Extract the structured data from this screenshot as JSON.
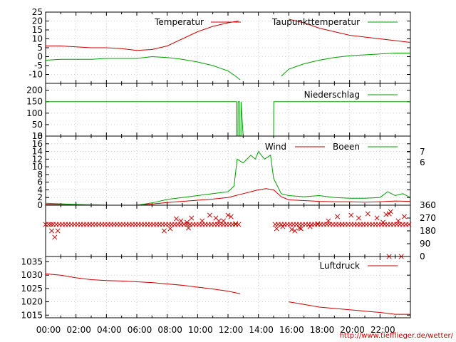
{
  "credit": "http://www.tiefflieger.de/wetter/",
  "x_ticks": [
    "00:00",
    "02:00",
    "04:00",
    "06:00",
    "08:00",
    "10:00",
    "12:00",
    "14:00",
    "16:00",
    "18:00",
    "20:00",
    "22:00"
  ],
  "colors": {
    "red": "#cc0000",
    "green": "#00a000",
    "grid": "#b0b0b0",
    "axis": "#000000"
  },
  "chart_data": [
    {
      "type": "line",
      "xlim": [
        0,
        24
      ],
      "ylim": [
        -15,
        25
      ],
      "y_ticks": [
        25,
        20,
        15,
        10,
        5,
        0,
        -5,
        -10
      ],
      "y_tick_labels": [
        "25",
        "20",
        "15",
        "10",
        "5",
        "0",
        "-5",
        "-10"
      ],
      "grid": true,
      "legend_placement": "top",
      "series": [
        {
          "name": "Temperatur",
          "color": "red",
          "x": [
            0,
            1,
            2,
            3,
            4,
            5,
            6,
            7,
            8,
            9,
            10,
            11,
            12,
            12.7,
            15,
            16,
            17,
            18,
            19,
            20,
            21,
            22,
            23,
            24
          ],
          "y": [
            6,
            6,
            5.5,
            5,
            5,
            4.5,
            3.5,
            4,
            6,
            10,
            14,
            17,
            19,
            20,
            null,
            21,
            19,
            16,
            14,
            12,
            11,
            10,
            9,
            8
          ]
        },
        {
          "name": "Taupunkttemperatur",
          "color": "green",
          "x": [
            0,
            1,
            2,
            3,
            4,
            5,
            6,
            7,
            8,
            9,
            10,
            11,
            11.5,
            12,
            12.5,
            12.8,
            15,
            15.5,
            16,
            17,
            18,
            19,
            20,
            21,
            22,
            23,
            24
          ],
          "y": [
            -2,
            -1.5,
            -1.5,
            -1.5,
            -1,
            -1,
            -1,
            0,
            -0.5,
            -1.5,
            -3,
            -5,
            -6.5,
            -8,
            -11,
            -13,
            null,
            -11,
            -7,
            -4,
            -2,
            -0.5,
            0.5,
            1,
            1.5,
            2,
            2
          ]
        }
      ]
    },
    {
      "type": "line",
      "xlim": [
        0,
        24
      ],
      "ylim": [
        0,
        230
      ],
      "y_ticks": [
        200,
        150,
        100,
        50,
        0
      ],
      "y_tick_labels": [
        "200",
        "150",
        "100",
        "50",
        "0"
      ],
      "grid": true,
      "legend_placement": "top-right",
      "series": [
        {
          "name": "Niederschlag",
          "color": "green",
          "x": [
            0,
            12.55,
            12.56,
            12.65,
            12.66,
            12.75,
            12.76,
            12.85,
            12.86,
            13.0,
            15.0,
            15.01,
            24
          ],
          "y": [
            150,
            150,
            0,
            0,
            150,
            150,
            0,
            0,
            150,
            0,
            0,
            150,
            150
          ]
        }
      ]
    },
    {
      "type": "line",
      "xlim": [
        0,
        24
      ],
      "ylim": [
        0,
        18
      ],
      "y_ticks": [
        18,
        16,
        14,
        12,
        10,
        8,
        6,
        4,
        2,
        0
      ],
      "y_tick_labels": [
        "18",
        "16",
        "14",
        "12",
        "10",
        "8",
        "6",
        "4",
        "2",
        "0"
      ],
      "y2_ticks": [
        7,
        6
      ],
      "y2_tick_labels": [
        "7",
        "6"
      ],
      "grid": true,
      "legend_placement": "top-right",
      "series": [
        {
          "name": "Wind",
          "color": "red",
          "x": [
            0,
            2,
            4,
            6,
            7,
            8,
            9,
            10,
            11,
            12,
            12.5,
            13,
            13.5,
            14,
            14.5,
            15,
            15.5,
            16,
            17,
            18,
            19,
            20,
            21,
            22,
            23,
            24
          ],
          "y": [
            0.2,
            0.1,
            0,
            0,
            0.3,
            0.7,
            1,
            1.3,
            1.6,
            2,
            2.5,
            3,
            3.5,
            4,
            4.3,
            4,
            2.2,
            1.4,
            1.2,
            1,
            0.9,
            0.9,
            0.8,
            0.9,
            1.1,
            1
          ]
        },
        {
          "name": "Boeen",
          "color": "green",
          "x": [
            0,
            2,
            4,
            6,
            7,
            8,
            9,
            10,
            11,
            12,
            12.4,
            12.6,
            13,
            13.5,
            13.8,
            14,
            14.4,
            14.8,
            15,
            15.5,
            16,
            17,
            18,
            19,
            20,
            21,
            22,
            22.5,
            23,
            23.5,
            24
          ],
          "y": [
            0.5,
            0.2,
            0,
            0,
            0.6,
            1.5,
            2,
            2.5,
            3,
            3.5,
            5,
            12,
            11,
            13,
            12,
            14,
            12,
            13,
            7,
            3,
            2.5,
            2.2,
            2.5,
            2,
            1.8,
            1.8,
            2,
            3.5,
            2.5,
            3,
            2
          ]
        }
      ]
    },
    {
      "type": "scatter",
      "xlim": [
        0,
        24
      ],
      "ylim": [
        0,
        360
      ],
      "y2_ticks": [
        360,
        270,
        180,
        90,
        0
      ],
      "y2_tick_labels": [
        "360",
        "270",
        "180",
        "90",
        "0"
      ],
      "grid": true,
      "series": [
        {
          "name": "",
          "color": "red",
          "x": [
            0,
            0.2,
            0.35,
            0.5,
            0.7,
            0.9,
            1.1,
            1.3,
            1.5,
            1.7,
            1.9,
            2.1,
            2.3,
            2.5,
            2.7,
            2.9,
            3.1,
            3.3,
            3.5,
            3.7,
            3.9,
            4.1,
            4.3,
            4.5,
            4.7,
            4.9,
            5.1,
            5.3,
            5.5,
            5.7,
            5.9,
            6.1,
            6.3,
            6.5,
            6.7,
            6.9,
            7.1,
            7.3,
            7.5,
            7.7,
            7.9,
            8.1,
            8.3,
            8.5,
            8.7,
            8.9,
            9.1,
            9.3,
            9.5,
            9.7,
            9.9,
            10.1,
            10.3,
            10.5,
            10.7,
            10.9,
            11.1,
            11.3,
            11.5,
            11.7,
            11.9,
            12.1,
            12.3,
            12.5,
            12.7,
            15.1,
            15.3,
            15.5,
            15.7,
            15.9,
            16.1,
            16.3,
            16.5,
            16.7,
            16.9,
            17.1,
            17.3,
            17.5,
            17.7,
            17.9,
            18.1,
            18.3,
            18.5,
            18.7,
            18.9,
            19.1,
            19.3,
            19.5,
            19.7,
            19.9,
            20.1,
            20.3,
            20.5,
            20.7,
            20.9,
            21.1,
            21.3,
            21.5,
            21.7,
            21.9,
            22.1,
            22.3,
            22.5,
            22.7,
            22.9,
            23.1,
            23.3,
            23.5,
            23.7,
            23.9,
            0.4,
            0.6,
            0.8,
            8.6,
            8.9,
            9.3,
            9.6,
            10.3,
            10.8,
            11.2,
            11.7,
            12.2,
            12.5,
            15.2,
            15.6,
            16.2,
            16.7,
            17.4,
            17.9,
            18.6,
            19.2,
            20.1,
            20.6,
            21.2,
            21.8,
            22.2,
            22.6,
            23.2,
            23.6,
            7.8,
            8.2,
            9.4,
            11.4,
            12.0,
            16.4,
            16.8,
            19.5,
            22.6,
            23.4,
            22.4,
            22.7
          ],
          "y": [
            225,
            225,
            225,
            225,
            225,
            225,
            225,
            225,
            225,
            225,
            225,
            225,
            225,
            225,
            225,
            225,
            225,
            225,
            225,
            225,
            225,
            225,
            225,
            225,
            225,
            225,
            225,
            225,
            225,
            225,
            225,
            225,
            225,
            225,
            225,
            225,
            225,
            225,
            225,
            225,
            225,
            225,
            225,
            225,
            225,
            225,
            225,
            225,
            225,
            225,
            225,
            225,
            225,
            225,
            225,
            225,
            225,
            225,
            225,
            225,
            225,
            225,
            225,
            225,
            225,
            225,
            225,
            225,
            225,
            225,
            225,
            225,
            225,
            225,
            225,
            225,
            225,
            225,
            225,
            225,
            225,
            225,
            225,
            225,
            225,
            225,
            225,
            225,
            225,
            225,
            225,
            225,
            225,
            225,
            225,
            225,
            225,
            225,
            225,
            225,
            225,
            225,
            225,
            225,
            225,
            225,
            225,
            225,
            225,
            225,
            180,
            135,
            180,
            265,
            250,
            240,
            270,
            250,
            290,
            270,
            250,
            280,
            230,
            195,
            210,
            190,
            200,
            210,
            230,
            250,
            280,
            290,
            270,
            300,
            270,
            240,
            300,
            250,
            280,
            180,
            195,
            200,
            250,
            290,
            180,
            195,
            225,
            0,
            0,
            295,
            315
          ]
        }
      ]
    },
    {
      "type": "line",
      "xlim": [
        0,
        24
      ],
      "ylim": [
        1014,
        1037
      ],
      "y_ticks": [
        1035,
        1030,
        1025,
        1020,
        1015
      ],
      "y_tick_labels": [
        "1035",
        "1030",
        "1025",
        "1020",
        "1015"
      ],
      "grid": true,
      "legend_placement": "top-right",
      "series": [
        {
          "name": "Luftdruck",
          "color": "red",
          "x": [
            0,
            1,
            2,
            3,
            4,
            5,
            6,
            7,
            8,
            9,
            10,
            11,
            12,
            12.8,
            15,
            16,
            17,
            18,
            19,
            20,
            21,
            22,
            23,
            24
          ],
          "y": [
            1030.5,
            1030,
            1029,
            1028.3,
            1028,
            1027.8,
            1027.5,
            1027.2,
            1026.7,
            1026.2,
            1025.5,
            1024.8,
            1024,
            1023,
            null,
            1020,
            1019,
            1018,
            1017.5,
            1017,
            1016.5,
            1016,
            1015.3,
            1015.3
          ]
        }
      ]
    }
  ]
}
